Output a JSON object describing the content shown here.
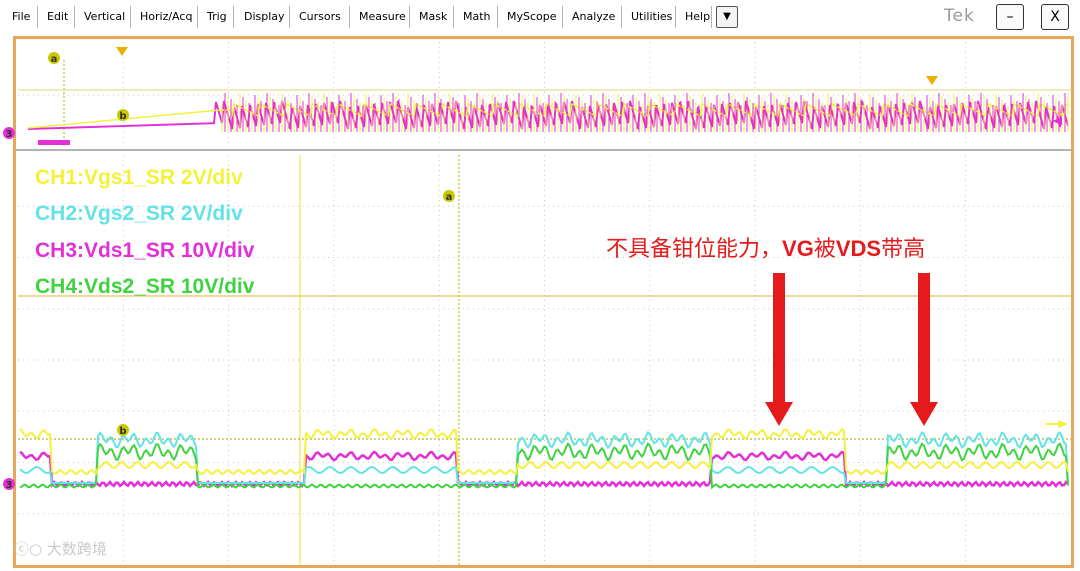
{
  "menu": {
    "items": [
      "File",
      "Edit",
      "Vertical",
      "Horiz/Acq",
      "Trig",
      "Display",
      "Cursors",
      "Measure",
      "Mask",
      "Math",
      "MyScope",
      "Analyze",
      "Utilities",
      "Help"
    ],
    "more_glyph": "▼"
  },
  "brand": "Tek",
  "window": {
    "minimize_glyph": "–",
    "close_glyph": "X"
  },
  "channels": [
    {
      "label": "CH1:Vgs1_SR 2V/div",
      "color": "#f2f23a"
    },
    {
      "label": "CH2:Vgs2_SR 2V/div",
      "color": "#63e3e6"
    },
    {
      "label": "CH3:Vds1_SR 10V/div",
      "color": "#e230d6"
    },
    {
      "label": "CH4:Vds2_SR 10V/div",
      "color": "#3fd33f"
    }
  ],
  "annotation": {
    "prefix": "不具备钳位能力，",
    "vg": "VG",
    "mid": "被",
    "vds": "VDS",
    "suffix": "带高"
  },
  "markers": {
    "cursor_a": "a",
    "cursor_b": "b",
    "ch3_ref": "3"
  },
  "watermark": "大数跨境",
  "colors": {
    "frame": "#e9a55a",
    "arrow": "#e51b1b",
    "grid": "#c8c8c8",
    "trigger": "#e8b000"
  }
}
